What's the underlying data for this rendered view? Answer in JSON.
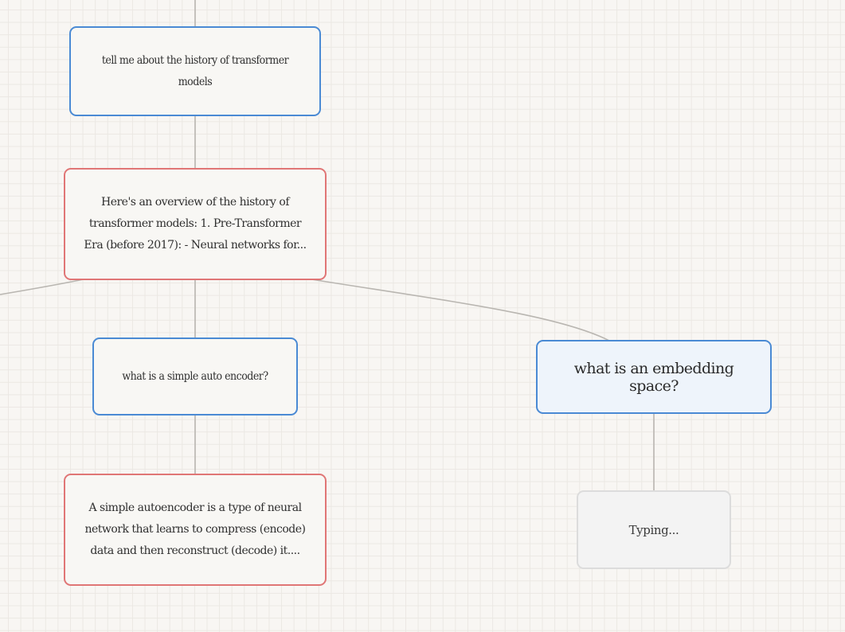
{
  "canvas": {
    "background": "#f8f6f3",
    "grid_color": "#ebe8e3",
    "edge_color": "#b9b6b1"
  },
  "colors": {
    "user_border": "#4a8ad4",
    "assistant_border": "#e07676",
    "selected_fill": "#eef4fb",
    "pending_border": "#dcdcdc"
  },
  "nodes": {
    "q1": {
      "role": "user",
      "text": "tell me about the history of transformer models"
    },
    "a1": {
      "role": "assistant",
      "text": "Here's an overview of the history of transformer models: 1. Pre-Transformer Era (before 2017): - Neural networks for..."
    },
    "q2": {
      "role": "user",
      "text": "what is a simple auto encoder?"
    },
    "a2": {
      "role": "assistant",
      "text": "A simple autoencoder is a type of neural network that learns to compress (encode) data and then reconstruct (decode) it...."
    },
    "q3": {
      "role": "user",
      "selected": true,
      "text": "what is an embedding space?"
    },
    "typing": {
      "role": "assistant",
      "pending": true,
      "text": "Typing..."
    }
  }
}
